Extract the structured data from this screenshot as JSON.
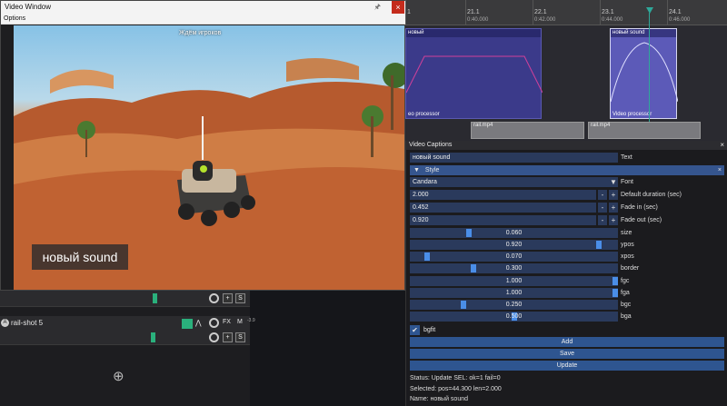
{
  "video_window": {
    "title": "Video Window",
    "menu": "Options",
    "pin_glyph": "🖈",
    "close_glyph": "×"
  },
  "scene": {
    "waiting": "Ждём игроков",
    "caption": "новый sound"
  },
  "timeline": {
    "ruler": [
      {
        "label": "21.1",
        "time": "0:40.000"
      },
      {
        "label": "22.1",
        "time": "0:42.000"
      },
      {
        "label": "23.1",
        "time": "0:44.000"
      },
      {
        "label": "24.1",
        "time": "0:46.000"
      }
    ],
    "ruler_partial": "1",
    "clips": [
      {
        "title": "новый",
        "footer": "eo processor"
      },
      {
        "title": "новый sound",
        "footer": "Video processor"
      }
    ],
    "mp4": [
      "rail.mp4",
      "rail.mp4"
    ]
  },
  "panel": {
    "title": "Video Captions",
    "close_glyph": "×",
    "text_value": "новый sound",
    "text_label": "Text",
    "style_label": "Style",
    "style_close": "×",
    "font_value": "Candara",
    "font_label": "Font",
    "numeric": [
      {
        "value": "2.000",
        "label": "Default duration (sec)"
      },
      {
        "value": "0.452",
        "label": "Fade in (sec)"
      },
      {
        "value": "0.920",
        "label": "Fade out (sec)"
      }
    ],
    "sliders": [
      {
        "value": "0.060",
        "label": "size",
        "pos": 0.28
      },
      {
        "value": "0.920",
        "label": "ypos",
        "pos": 0.92
      },
      {
        "value": "0.070",
        "label": "xpos",
        "pos": 0.07
      },
      {
        "value": "0.300",
        "label": "border",
        "pos": 0.3
      },
      {
        "value": "1.000",
        "label": "fgc",
        "pos": 1.0
      },
      {
        "value": "1.000",
        "label": "fga",
        "pos": 1.0
      },
      {
        "value": "0.250",
        "label": "bgc",
        "pos": 0.25
      },
      {
        "value": "0.500",
        "label": "bga",
        "pos": 0.5
      }
    ],
    "bgfit_label": "bgfit",
    "check_glyph": "✔",
    "buttons": {
      "add": "Add",
      "save": "Save",
      "update": "Update"
    },
    "status": [
      "Status: Update SEL: ok=1 fail=0",
      "Selected: pos=44.300 len=2.000",
      "Name: новый sound"
    ],
    "plus": "+",
    "minus": "-",
    "dropdown_glyph": "▼",
    "collapse_glyph": "▼"
  },
  "tracks": {
    "track_name": "rail-shot 5",
    "track_letter": "A",
    "fx": "FX",
    "m": "M",
    "s": "S",
    "plus": "+",
    "add_glyph": "⊕",
    "meter": "-3.9"
  }
}
